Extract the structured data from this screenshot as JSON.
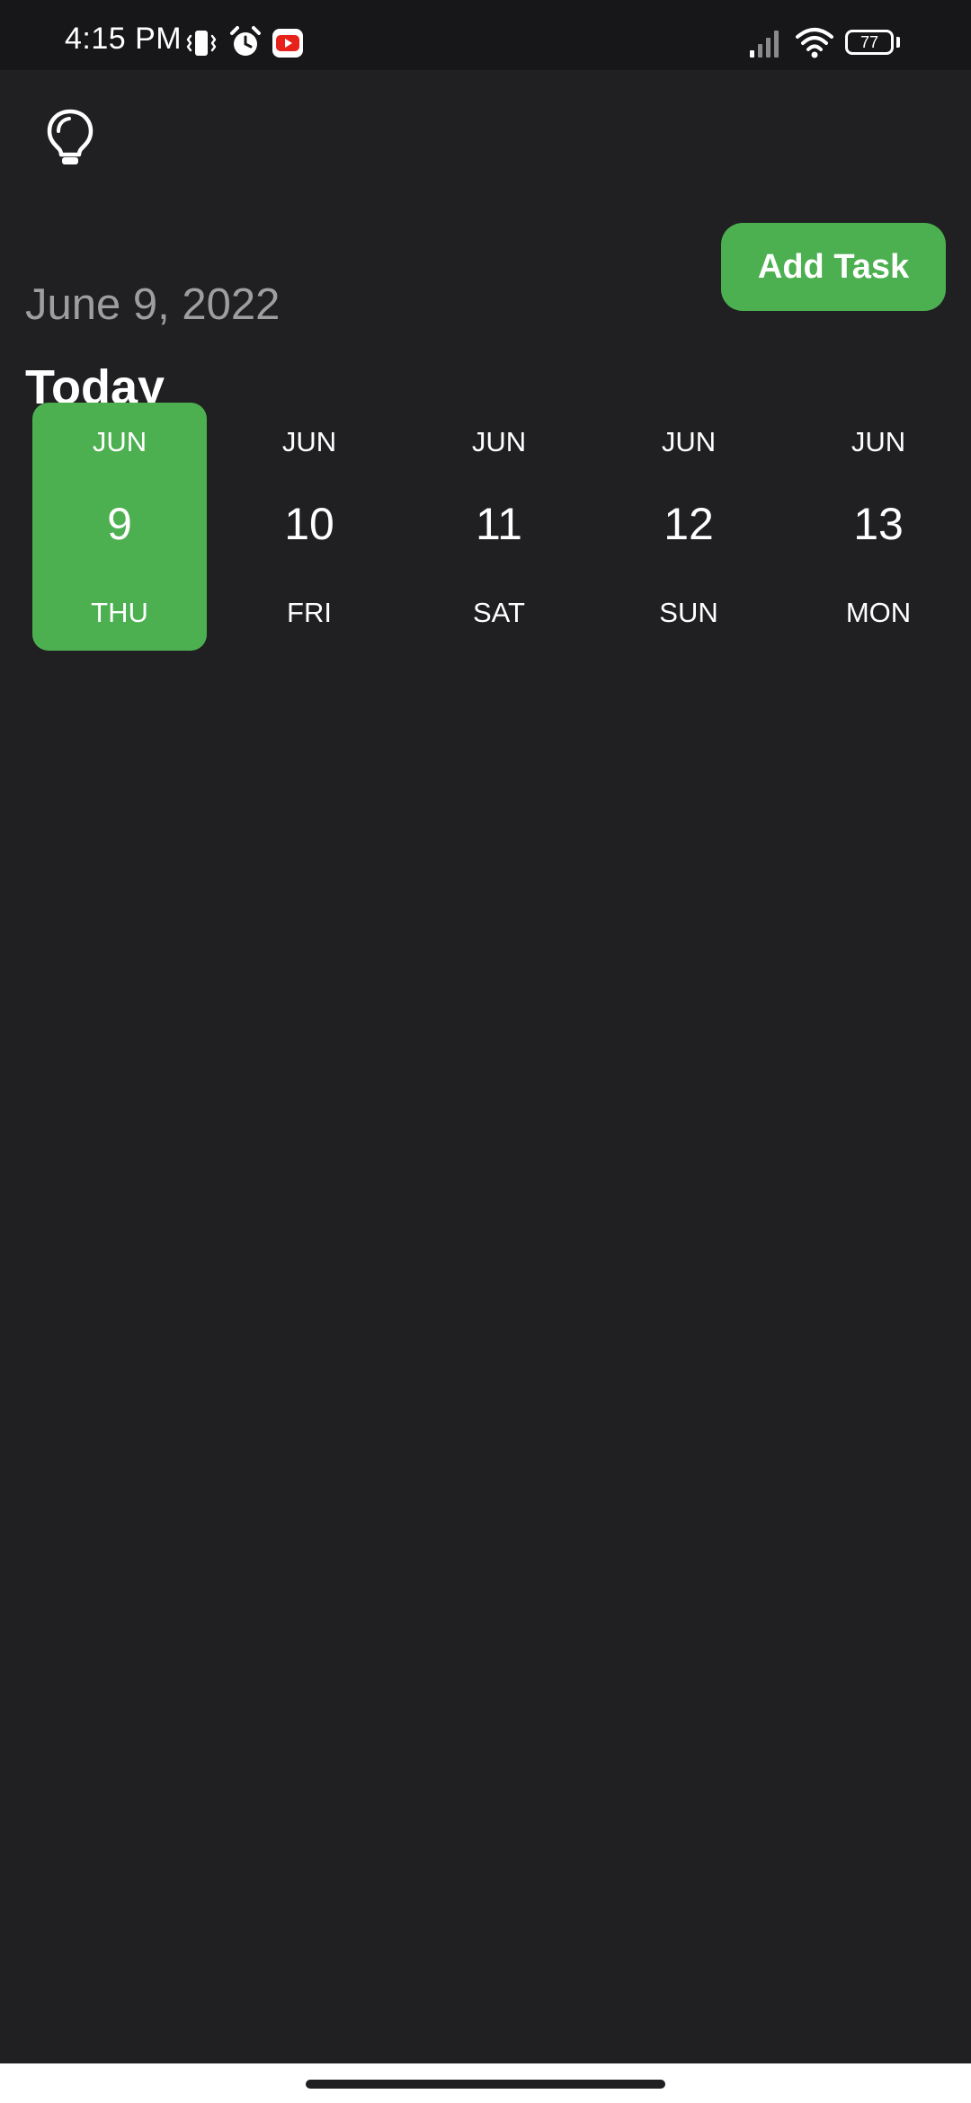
{
  "status_bar": {
    "time": "4:15 PM",
    "icons": [
      "vibrate-icon",
      "alarm-icon",
      "youtube-icon",
      "signal-icon",
      "wifi-icon",
      "battery-icon"
    ],
    "battery_level": "77"
  },
  "header": {
    "theme_toggle_icon": "lightbulb-icon",
    "date_label": "June 9, 2022",
    "add_task_label": "Add Task",
    "today_heading": "Today"
  },
  "date_strip": {
    "items": [
      {
        "month": "JUN",
        "day": "9",
        "weekday": "THU",
        "selected": true
      },
      {
        "month": "JUN",
        "day": "10",
        "weekday": "FRI",
        "selected": false
      },
      {
        "month": "JUN",
        "day": "11",
        "weekday": "SAT",
        "selected": false
      },
      {
        "month": "JUN",
        "day": "12",
        "weekday": "SUN",
        "selected": false
      },
      {
        "month": "JUN",
        "day": "13",
        "weekday": "MON",
        "selected": false
      }
    ]
  },
  "colors": {
    "background": "#202022",
    "status_bar": "#17171a",
    "accent": "#4caf50",
    "muted_text": "#9e9ea0",
    "text": "#ffffff"
  }
}
